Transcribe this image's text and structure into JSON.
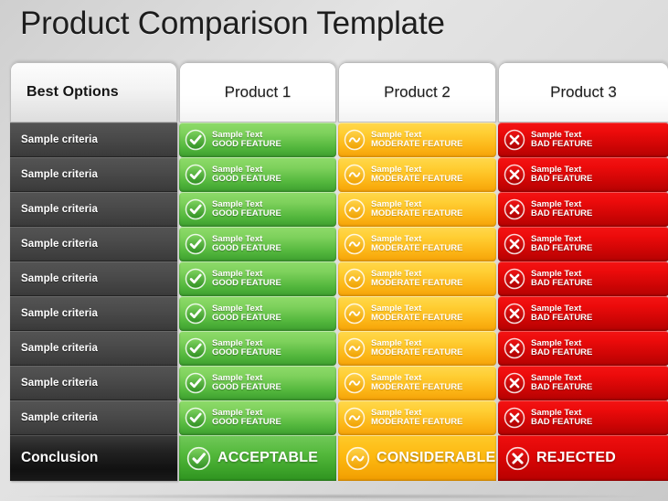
{
  "title": "Product Comparison Template",
  "theme": {
    "good_color": "#5ec043",
    "moderate_color": "#fcb516",
    "bad_color": "#e00808",
    "criteria_color": "#464646",
    "conclusion_color": "#161616",
    "header_color": "#ffffff",
    "background_color": "#d8d8d8"
  },
  "header": {
    "best_options_label": "Best Options",
    "columns": [
      {
        "label": "Product 1"
      },
      {
        "label": "Product 2"
      },
      {
        "label": "Product 3"
      }
    ]
  },
  "rows": [
    {
      "criteria": "Sample criteria",
      "cells": [
        {
          "status": "good",
          "icon": "check-icon",
          "line1": "Sample Text",
          "line2": "GOOD FEATURE"
        },
        {
          "status": "moderate",
          "icon": "tilde-icon",
          "line1": "Sample Text",
          "line2": "MODERATE  FEATURE"
        },
        {
          "status": "bad",
          "icon": "x-icon",
          "line1": "Sample Text",
          "line2": "BAD FEATURE"
        }
      ]
    },
    {
      "criteria": "Sample criteria",
      "cells": [
        {
          "status": "good",
          "icon": "check-icon",
          "line1": "Sample Text",
          "line2": "GOOD FEATURE"
        },
        {
          "status": "moderate",
          "icon": "tilde-icon",
          "line1": "Sample Text",
          "line2": "MODERATE  FEATURE"
        },
        {
          "status": "bad",
          "icon": "x-icon",
          "line1": "Sample Text",
          "line2": "BAD FEATURE"
        }
      ]
    },
    {
      "criteria": "Sample criteria",
      "cells": [
        {
          "status": "good",
          "icon": "check-icon",
          "line1": "Sample Text",
          "line2": "GOOD FEATURE"
        },
        {
          "status": "moderate",
          "icon": "tilde-icon",
          "line1": "Sample Text",
          "line2": "MODERATE  FEATURE"
        },
        {
          "status": "bad",
          "icon": "x-icon",
          "line1": "Sample Text",
          "line2": "BAD FEATURE"
        }
      ]
    },
    {
      "criteria": "Sample criteria",
      "cells": [
        {
          "status": "good",
          "icon": "check-icon",
          "line1": "Sample Text",
          "line2": "GOOD FEATURE"
        },
        {
          "status": "moderate",
          "icon": "tilde-icon",
          "line1": "Sample Text",
          "line2": "MODERATE  FEATURE"
        },
        {
          "status": "bad",
          "icon": "x-icon",
          "line1": "Sample Text",
          "line2": "BAD FEATURE"
        }
      ]
    },
    {
      "criteria": "Sample criteria",
      "cells": [
        {
          "status": "good",
          "icon": "check-icon",
          "line1": "Sample Text",
          "line2": "GOOD FEATURE"
        },
        {
          "status": "moderate",
          "icon": "tilde-icon",
          "line1": "Sample Text",
          "line2": "MODERATE  FEATURE"
        },
        {
          "status": "bad",
          "icon": "x-icon",
          "line1": "Sample Text",
          "line2": "BAD FEATURE"
        }
      ]
    },
    {
      "criteria": "Sample criteria",
      "cells": [
        {
          "status": "good",
          "icon": "check-icon",
          "line1": "Sample Text",
          "line2": "GOOD FEATURE"
        },
        {
          "status": "moderate",
          "icon": "tilde-icon",
          "line1": "Sample Text",
          "line2": "MODERATE  FEATURE"
        },
        {
          "status": "bad",
          "icon": "x-icon",
          "line1": "Sample Text",
          "line2": "BAD FEATURE"
        }
      ]
    },
    {
      "criteria": "Sample criteria",
      "cells": [
        {
          "status": "good",
          "icon": "check-icon",
          "line1": "Sample Text",
          "line2": "GOOD FEATURE"
        },
        {
          "status": "moderate",
          "icon": "tilde-icon",
          "line1": "Sample Text",
          "line2": "MODERATE  FEATURE"
        },
        {
          "status": "bad",
          "icon": "x-icon",
          "line1": "Sample Text",
          "line2": "BAD FEATURE"
        }
      ]
    },
    {
      "criteria": "Sample criteria",
      "cells": [
        {
          "status": "good",
          "icon": "check-icon",
          "line1": "Sample Text",
          "line2": "GOOD FEATURE"
        },
        {
          "status": "moderate",
          "icon": "tilde-icon",
          "line1": "Sample Text",
          "line2": "MODERATE  FEATURE"
        },
        {
          "status": "bad",
          "icon": "x-icon",
          "line1": "Sample Text",
          "line2": "BAD FEATURE"
        }
      ]
    },
    {
      "criteria": "Sample criteria",
      "cells": [
        {
          "status": "good",
          "icon": "check-icon",
          "line1": "Sample Text",
          "line2": "GOOD FEATURE"
        },
        {
          "status": "moderate",
          "icon": "tilde-icon",
          "line1": "Sample Text",
          "line2": "MODERATE  FEATURE"
        },
        {
          "status": "bad",
          "icon": "x-icon",
          "line1": "Sample Text",
          "line2": "BAD FEATURE"
        }
      ]
    }
  ],
  "conclusion": {
    "label": "Conclusion",
    "cells": [
      {
        "status": "good",
        "icon": "check-icon",
        "word": "ACCEPTABLE"
      },
      {
        "status": "moderate",
        "icon": "tilde-icon",
        "word": "CONSIDERABLE"
      },
      {
        "status": "bad",
        "icon": "x-icon",
        "word": "REJECTED"
      }
    ]
  }
}
